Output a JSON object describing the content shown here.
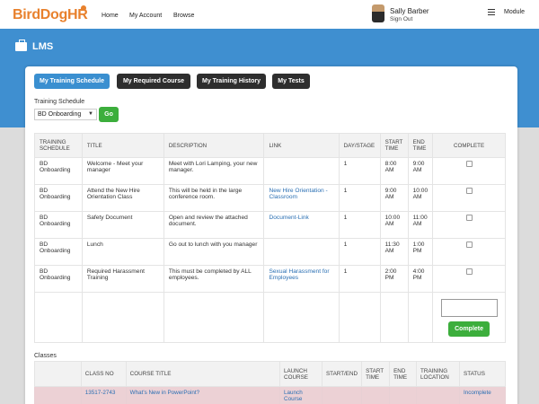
{
  "nav": {
    "logo_bird": "BirdDog",
    "logo_hr": "HR",
    "links": [
      "Home",
      "My Account",
      "Browse"
    ],
    "user_name": "Sally Barber",
    "sign_out": "Sign Out",
    "module": "Module"
  },
  "header": {
    "title": "LMS"
  },
  "tabs": [
    "My Training Schedule",
    "My Required Course",
    "My Training History",
    "My Tests"
  ],
  "schedule_filter": {
    "label": "Training Schedule",
    "selected": "BD Onboarding",
    "go_label": "Go"
  },
  "schedule_table": {
    "headers": [
      "TRAINING SCHEDULE",
      "TITLE",
      "DESCRIPTION",
      "LINK",
      "DAY/STAGE",
      "START TIME",
      "END TIME",
      "COMPLETE"
    ],
    "rows": [
      {
        "schedule": "BD Onboarding",
        "title": "Welcome - Meet your manager",
        "description": "Meet with Lori Lamping, your new manager.",
        "link": "",
        "day": "1",
        "start": "8:00 AM",
        "end": "9:00 AM"
      },
      {
        "schedule": "BD Onboarding",
        "title": "Attend the New Hire Orientation Class",
        "description": "This will be held in the large conference room.",
        "link": "New Hire Orientation - Classroom",
        "day": "1",
        "start": "9:00 AM",
        "end": "10:00 AM"
      },
      {
        "schedule": "BD Onboarding",
        "title": "Safety Document",
        "description": "Open and review the attached document.",
        "link": "Document-Link",
        "day": "1",
        "start": "10:00 AM",
        "end": "11:00 AM"
      },
      {
        "schedule": "BD Onboarding",
        "title": "Lunch",
        "description": "Go out to lunch with you manager",
        "link": "",
        "day": "1",
        "start": "11:30 AM",
        "end": "1:00 PM"
      },
      {
        "schedule": "BD Onboarding",
        "title": "Required Harassment Training",
        "description": "This must be completed by ALL employees.",
        "link": "Sexual Harassment for Employees",
        "day": "1",
        "start": "2:00 PM",
        "end": "4:00 PM"
      }
    ],
    "complete_button": "Complete"
  },
  "classes": {
    "label": "Classes",
    "headers": [
      "",
      "CLASS NO",
      "COURSE TITLE",
      "LAUNCH COURSE",
      "START/END",
      "START TIME",
      "END TIME",
      "TRAINING LOCATION",
      "STATUS"
    ],
    "rows": [
      {
        "class_no": "13517-2743",
        "course_title": "What's New in PowerPoint?",
        "launch": "Launch Course",
        "status": "Incomplete"
      }
    ]
  }
}
